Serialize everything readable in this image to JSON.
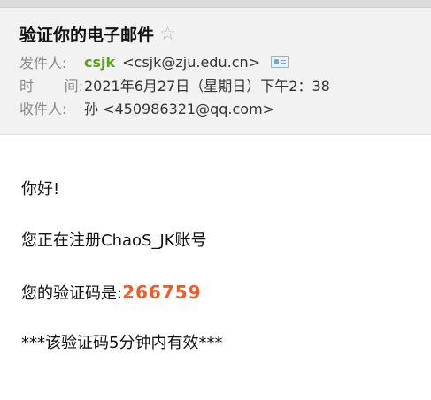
{
  "email": {
    "subject": "验证你的电子邮件",
    "star_icon": "star-outline-icon",
    "from": {
      "label_parts": [
        "发件人:"
      ],
      "name": "csjk",
      "address": "<csjk@zju.edu.cn>",
      "card_icon": "contact-card-icon"
    },
    "time": {
      "label_parts": [
        "时",
        "间:"
      ],
      "value": "2021年6月27日（星期日）下午2：38"
    },
    "to": {
      "label_parts": [
        "收件人:"
      ],
      "value": "孙 <450986321@qq.com>"
    },
    "body": {
      "greeting": "你好!",
      "registering": "您正在注册ChaoS_JK账号",
      "code_label": "您的验证码是:",
      "code": "266759",
      "validity": "***该验证码5分钟内有效***"
    },
    "colors": {
      "sender_name": "#5aa519",
      "code": "#f15a2b",
      "header_bg": "#f2f2f2"
    }
  }
}
